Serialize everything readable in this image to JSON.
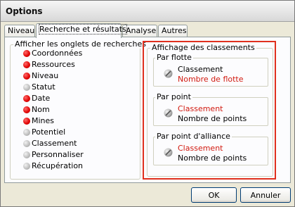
{
  "window": {
    "title": "Options"
  },
  "tabs": [
    {
      "label": "Niveau",
      "active": false
    },
    {
      "label": "Recherche et résultats",
      "active": true
    },
    {
      "label": "Analyse",
      "active": false
    },
    {
      "label": "Autres",
      "active": false
    }
  ],
  "search_tabs": {
    "title": "Afficher les onglets de recherches",
    "items": [
      {
        "label": "Coordonnées",
        "enabled": true
      },
      {
        "label": "Ressources",
        "enabled": true
      },
      {
        "label": "Niveau",
        "enabled": true
      },
      {
        "label": "Statut",
        "enabled": false
      },
      {
        "label": "Date",
        "enabled": true
      },
      {
        "label": "Nom",
        "enabled": true
      },
      {
        "label": "Mines",
        "enabled": true
      },
      {
        "label": "Potentiel",
        "enabled": false
      },
      {
        "label": "Classement",
        "enabled": false
      },
      {
        "label": "Personnaliser",
        "enabled": false
      },
      {
        "label": "Récupération",
        "enabled": false
      }
    ]
  },
  "rankings": {
    "title": "Affichage des classements",
    "groups": [
      {
        "title": "Par flotte",
        "primary": "Classement",
        "secondary": "Nombre de flotte",
        "highlighted": "secondary"
      },
      {
        "title": "Par point",
        "primary": "Classement",
        "secondary": "Nombre de points",
        "highlighted": "primary"
      },
      {
        "title": "Par point d'alliance",
        "primary": "Classement",
        "secondary": "Nombre de points",
        "highlighted": "primary"
      }
    ]
  },
  "buttons": {
    "ok": "OK",
    "cancel": "Annuler"
  },
  "colors": {
    "enabled_dot": "#e00000",
    "disabled_dot": "#bcbcbc",
    "highlight_text": "#d11a10",
    "focus_frame": "#e0301e"
  }
}
